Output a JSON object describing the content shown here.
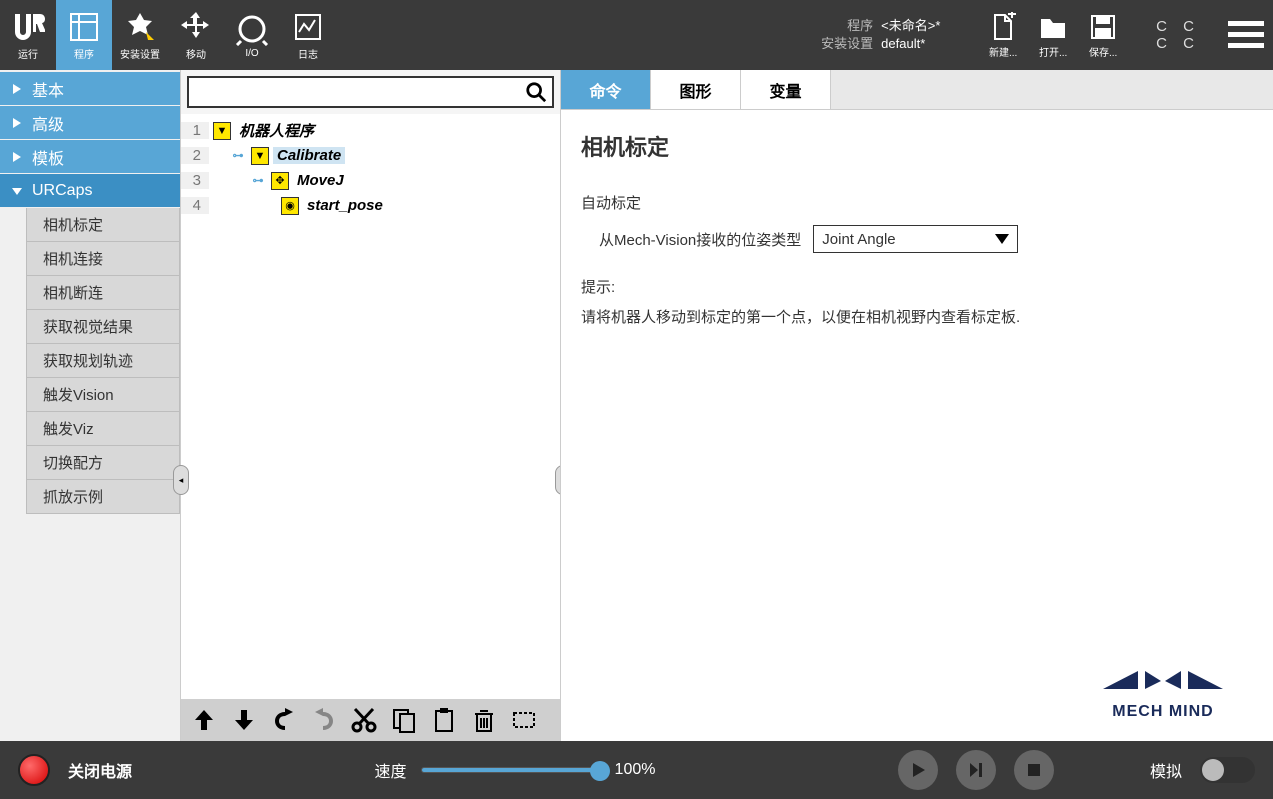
{
  "topbar": {
    "tabs": [
      "运行",
      "程序",
      "安装设置",
      "移动",
      "I/O",
      "日志"
    ],
    "meta": {
      "program_label": "程序",
      "program_value": "<未命名>*",
      "install_label": "安装设置",
      "install_value": "default*"
    },
    "file_btns": {
      "new": "新建...",
      "open": "打开...",
      "save": "保存..."
    }
  },
  "leftnav": {
    "sections": [
      "基本",
      "高级",
      "模板",
      "URCaps"
    ],
    "urcaps_items": [
      "相机标定",
      "相机连接",
      "相机断连",
      "获取视觉结果",
      "获取规划轨迹",
      "触发Vision",
      "触发Viz",
      "切换配方",
      "抓放示例"
    ]
  },
  "tree": {
    "rows": [
      {
        "n": "1",
        "label": "机器人程序",
        "indent": 0,
        "icon": "▼"
      },
      {
        "n": "2",
        "label": "Calibrate",
        "indent": 1,
        "icon": "▼",
        "selected": true
      },
      {
        "n": "3",
        "label": "MoveJ",
        "indent": 2,
        "icon": "✥"
      },
      {
        "n": "4",
        "label": "start_pose",
        "indent": 3,
        "icon": "◉"
      }
    ]
  },
  "detail": {
    "tabs": [
      "命令",
      "图形",
      "变量"
    ],
    "title": "相机标定",
    "auto_label": "自动标定",
    "pose_label": "从Mech-Vision接收的位姿类型",
    "pose_value": "Joint Angle",
    "hint_label": "提示:",
    "hint_text": "请将机器人移动到标定的第一个点，以便在相机视野内查看标定板.",
    "logo_text": "MECH MIND"
  },
  "bottom": {
    "power": "关闭电源",
    "speed_label": "速度",
    "speed_pct": "100%",
    "sim_label": "模拟"
  }
}
